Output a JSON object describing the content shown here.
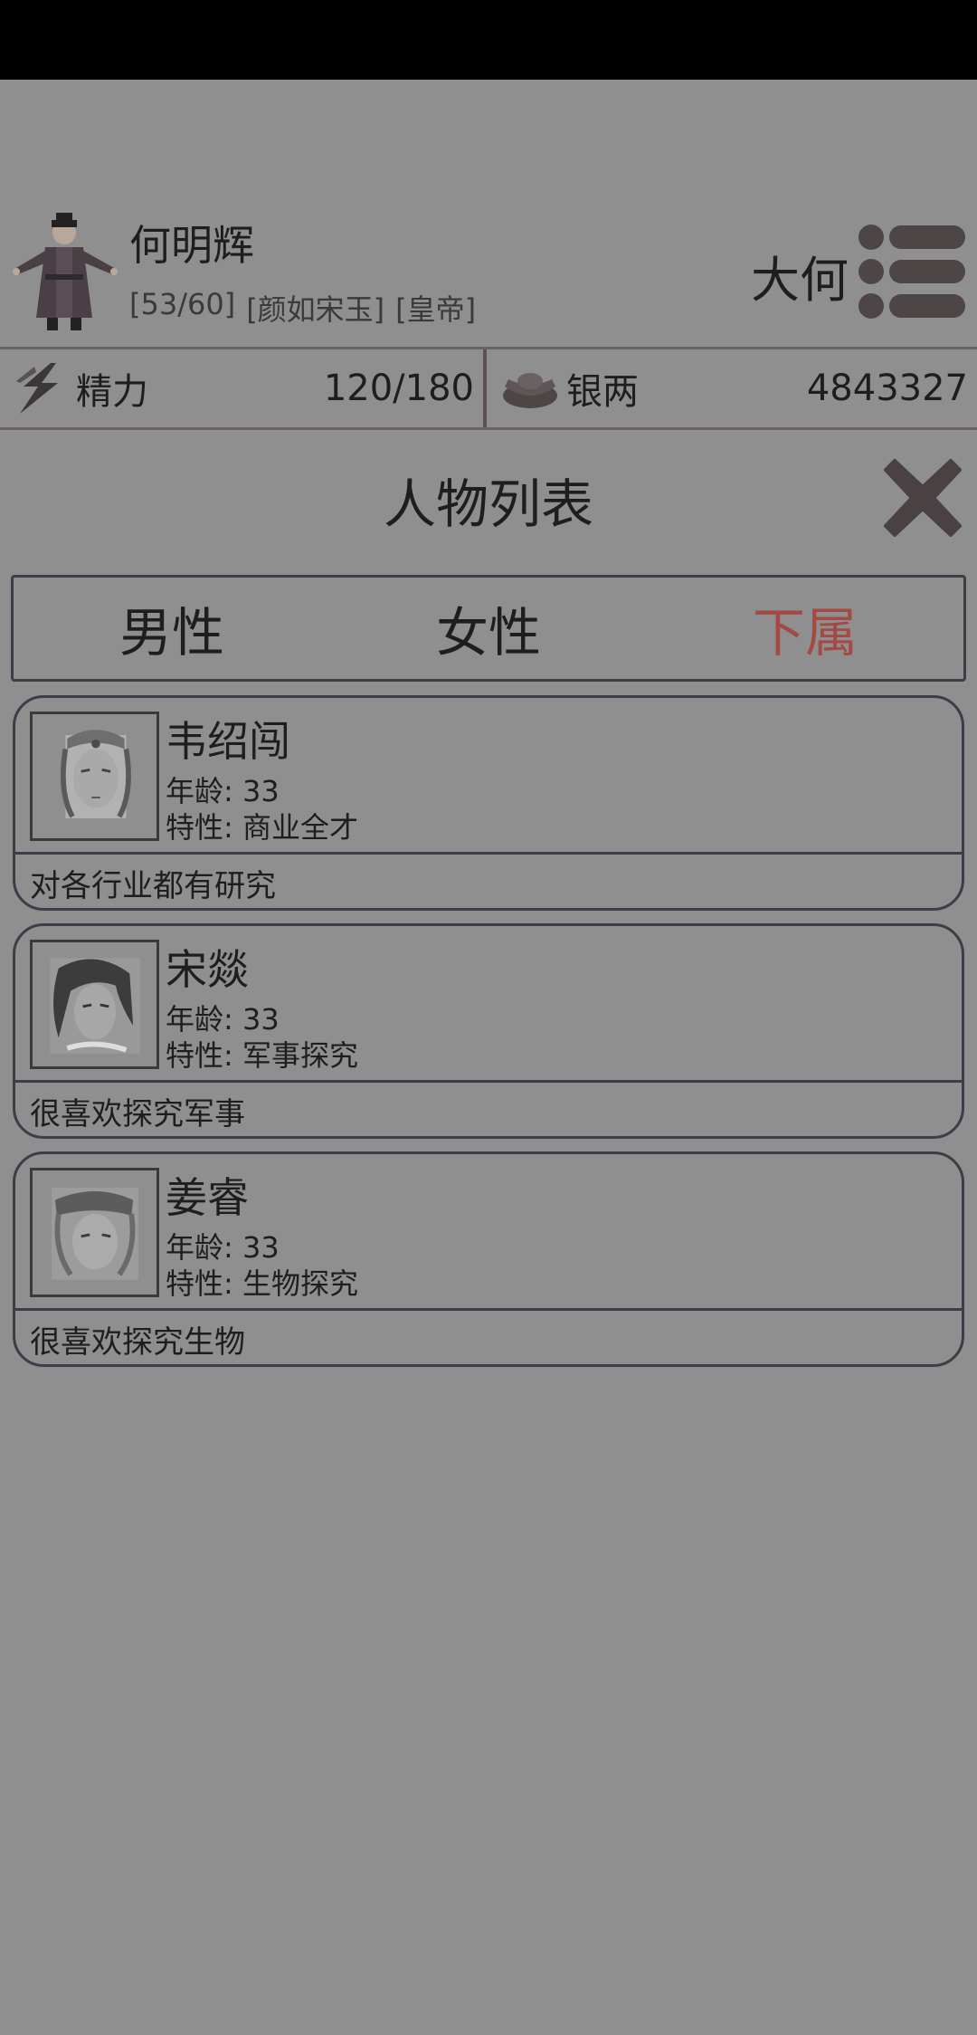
{
  "header": {
    "player_name": "何明辉",
    "tags": [
      "[53/60]",
      "[颜如宋玉]",
      "[皇帝]"
    ],
    "realm": "大何"
  },
  "resources": {
    "energy": {
      "label": "精力",
      "value": "120/180",
      "icon": "lightning-icon"
    },
    "silver": {
      "label": "银两",
      "value": "4843327",
      "icon": "silver-ingot-icon"
    }
  },
  "panel": {
    "title": "人物列表",
    "tabs": [
      {
        "label": "男性",
        "active": false
      },
      {
        "label": "女性",
        "active": false
      },
      {
        "label": "下属",
        "active": true
      }
    ]
  },
  "people": [
    {
      "name": "韦绍闯",
      "age": "年龄: 33",
      "trait": "特性: 商业全才",
      "desc": "对各行业都有研究"
    },
    {
      "name": "宋燚",
      "age": "年龄: 33",
      "trait": "特性: 军事探究",
      "desc": "很喜欢探究军事"
    },
    {
      "name": "姜睿",
      "age": "年龄: 33",
      "trait": "特性: 生物探究",
      "desc": "很喜欢探究生物"
    }
  ],
  "colors": {
    "active_tab": "#a44a45",
    "overlay": "#8f8f8f",
    "border": "#3f3c48"
  }
}
